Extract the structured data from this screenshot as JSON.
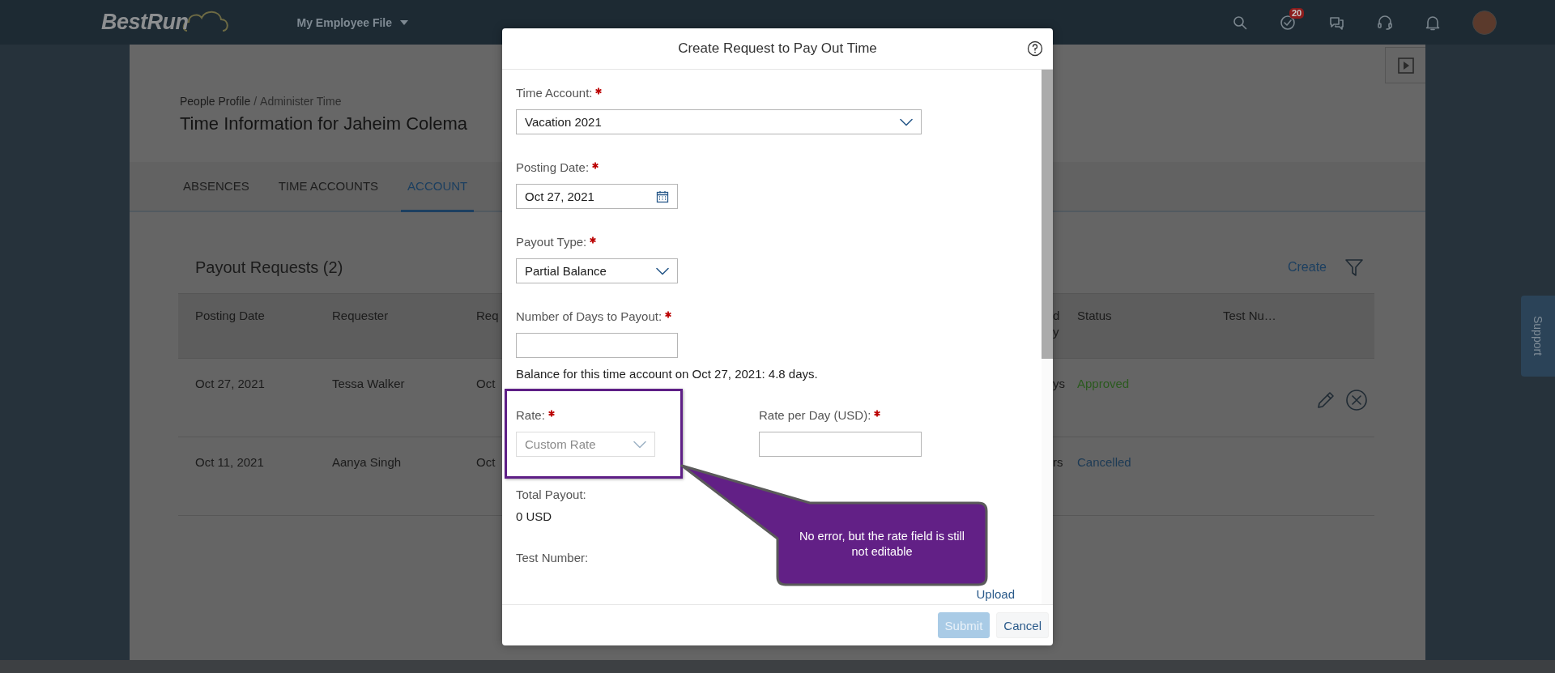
{
  "top_bar": {
    "logo": "BestRun",
    "menu": "My Employee File",
    "tasks_badge": "20"
  },
  "page": {
    "breadcrumb": {
      "link": "People Profile",
      "separator": "/",
      "current": "Administer Time"
    },
    "title": "Time Information for Jaheim Colema",
    "tabs": [
      {
        "label": "ABSENCES",
        "selected": false
      },
      {
        "label": "TIME ACCOUNTS",
        "selected": false
      },
      {
        "label": "ACCOUNT",
        "selected": true
      }
    ],
    "payout_requests": {
      "title": "Payout Requests (2)",
      "create": "Create",
      "columns": [
        "Posting Date",
        "Requester",
        "Req",
        "d y",
        "Status",
        "Test Nu…"
      ],
      "rows": [
        {
          "cells": [
            "Oct 27, 2021",
            "Tessa Walker",
            "Oct",
            "ys"
          ],
          "status": "Approved",
          "color": "#2b5a1f",
          "actions": true
        },
        {
          "cells": [
            "Oct 11, 2021",
            "Aanya Singh",
            "Oct",
            "rs"
          ],
          "status": "Cancelled",
          "color": "#1c3a55",
          "actions": false
        }
      ]
    }
  },
  "support": "Support",
  "dialog": {
    "title": "Create Request to Pay Out Time",
    "fields": [
      {
        "label": "Time Account:",
        "required": true,
        "kind": "select",
        "value": "Vacation 2021",
        "disabled": false
      },
      {
        "label": "Posting Date:",
        "required": true,
        "kind": "date",
        "value": "Oct 27, 2021",
        "disabled": false
      },
      {
        "label": "Payout Type:",
        "required": true,
        "kind": "select",
        "value": "Partial Balance",
        "disabled": false
      },
      {
        "label": "Number of Days to Payout:",
        "required": true,
        "kind": "text",
        "disabled": false
      }
    ],
    "balance_note": "Balance for this time account on Oct 27, 2021: 4.8 days.",
    "rate_fields": [
      {
        "label": "Rate:",
        "required": true,
        "kind": "select",
        "value": "Custom Rate",
        "disabled": true,
        "highlighted": true
      },
      {
        "label": "Rate per Day (USD):",
        "required": true,
        "kind": "text",
        "disabled": false,
        "highlighted": false
      }
    ],
    "total_payout": {
      "label": "Total Payout:",
      "value": "0 USD"
    },
    "test_number": {
      "label": "Test Number:"
    },
    "upload": "Upload",
    "buttons": [
      {
        "label": "Submit",
        "kind": "primary",
        "disabled": true
      },
      {
        "label": "Cancel",
        "kind": "secondary",
        "disabled": false
      }
    ]
  },
  "callout": {
    "text": "No error, but the rate field is still not editable"
  }
}
